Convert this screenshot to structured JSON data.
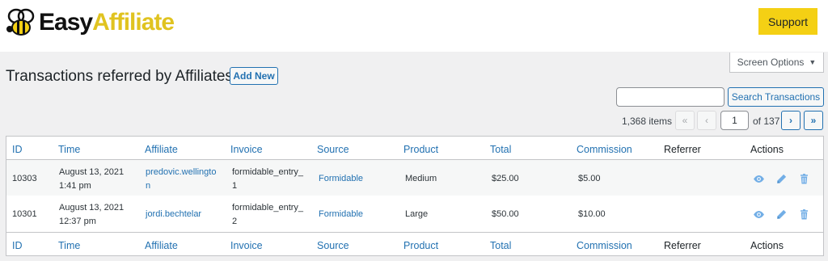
{
  "brand": {
    "part1": "Easy",
    "part2": "Affiliate"
  },
  "header": {
    "support_label": "Support"
  },
  "screen_options": {
    "label": "Screen Options",
    "caret": "▼"
  },
  "page": {
    "title": "Transactions referred by Affiliates",
    "add_new_label": "Add New"
  },
  "search": {
    "value": "",
    "button_label": "Search Transactions"
  },
  "pagination": {
    "items_text": "1,368 items",
    "first": "«",
    "prev": "‹",
    "next": "›",
    "last": "»",
    "current_page": "1",
    "of_text": "of 137"
  },
  "table": {
    "columns": [
      "ID",
      "Time",
      "Affiliate",
      "Invoice",
      "Source",
      "Product",
      "Total",
      "Commission",
      "Referrer",
      "Actions"
    ],
    "rows": [
      {
        "id": "10303",
        "time_line1": "August 13, 2021",
        "time_line2": "1:41 pm",
        "affiliate_line1": "predovic.wellingto",
        "affiliate_line2": "n",
        "invoice_line1": "formidable_entry_",
        "invoice_line2": "1",
        "source": "Formidable",
        "product": "Medium",
        "total": "$25.00",
        "commission": "$5.00",
        "referrer": ""
      },
      {
        "id": "10301",
        "time_line1": "August 13, 2021",
        "time_line2": "12:37 pm",
        "affiliate_line1": "jordi.bechtelar",
        "affiliate_line2": "",
        "invoice_line1": "formidable_entry_",
        "invoice_line2": "2",
        "source": "Formidable",
        "product": "Large",
        "total": "$50.00",
        "commission": "$10.00",
        "referrer": ""
      }
    ],
    "row_action_icons": [
      "view-icon",
      "edit-icon",
      "trash-icon"
    ]
  },
  "colors": {
    "brand_yellow": "#f4d014",
    "link_blue": "#2271b1",
    "action_icon": "#72aee6"
  }
}
